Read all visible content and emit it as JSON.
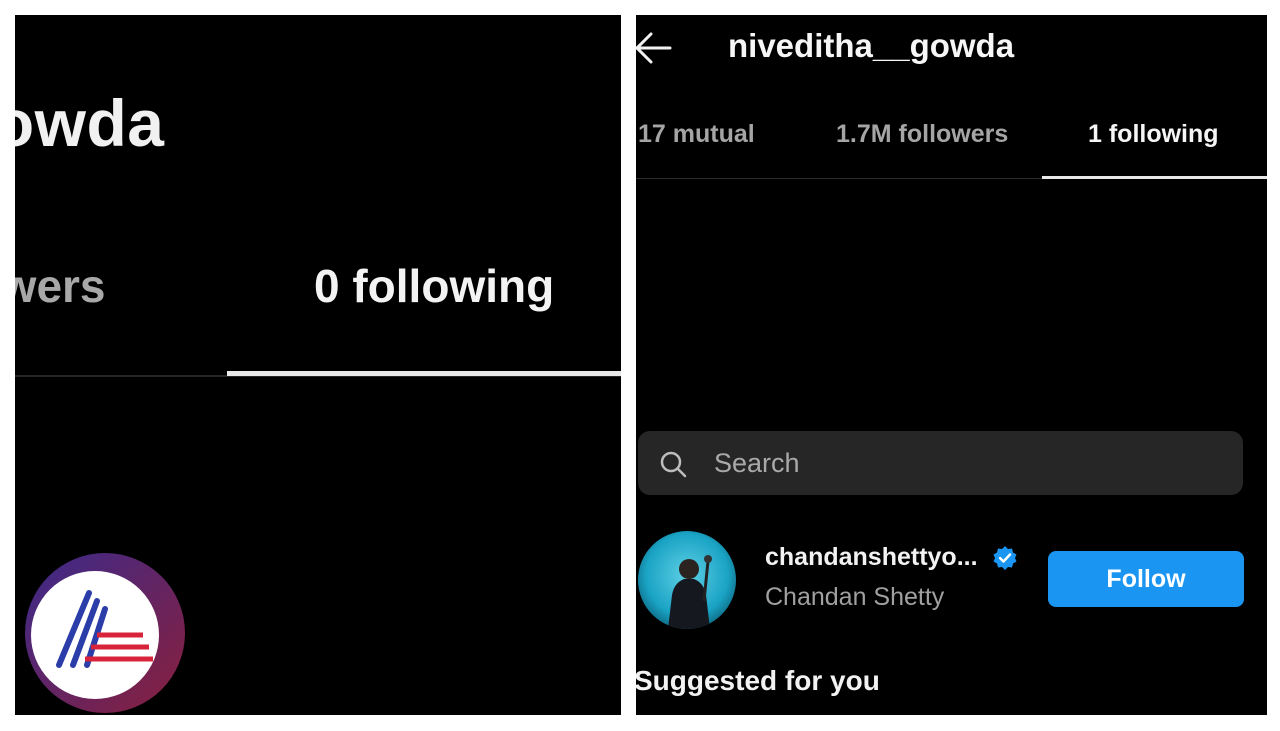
{
  "left_panel": {
    "username_fragment": "gowda",
    "tabs": [
      {
        "label": "llowers",
        "active": false
      },
      {
        "label": "0 following",
        "active": true
      }
    ],
    "watermark_icon": "asianet-logo-icon"
  },
  "right_panel": {
    "header": {
      "back_icon": "arrow-left-icon",
      "username": "niveditha__gowda"
    },
    "tabs": [
      {
        "label": "17 mutual",
        "active": false
      },
      {
        "label": "1.7M followers",
        "active": false
      },
      {
        "label": "1 following",
        "active": true
      }
    ],
    "search": {
      "icon": "search-icon",
      "placeholder": "Search",
      "value": ""
    },
    "following_list": [
      {
        "handle": "chandanshettyo...",
        "name": "Chandan Shetty",
        "verified": true,
        "button_label": "Follow"
      }
    ],
    "suggested_heading": "Suggested for you"
  },
  "colors": {
    "background": "#000000",
    "text_primary": "#f2f2f2",
    "text_secondary": "#a5a5a5",
    "search_bg": "#262626",
    "follow_button": "#1a95f2",
    "verified_badge": "#1a95f2"
  }
}
